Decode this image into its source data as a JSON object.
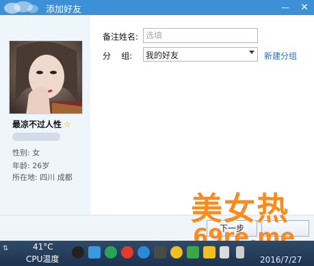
{
  "window": {
    "title": "添加好友",
    "minimize_icon": "minimize-icon",
    "close_icon": "close-icon",
    "minimize_glyph": "—",
    "close_glyph": "✕"
  },
  "profile": {
    "nickname": "最凉不过人性",
    "star_icon": "star-icon",
    "gender": "性别: 女",
    "age": "年龄: 26岁",
    "location": "所在地: 四川  成都"
  },
  "form": {
    "remark_label": "备注姓名:",
    "remark_placeholder": "选填",
    "remark_value": "",
    "group_label": "分    组:",
    "group_value": "我的好友",
    "new_group_link": "新建分组"
  },
  "buttons": {
    "next_label": "下一步"
  },
  "watermark": {
    "main": "美女热",
    "url": "69re.me"
  },
  "taskbar": {
    "cpu_temp": "41°C",
    "cpu_label": "CPU温度",
    "date": "2016/7/27"
  },
  "colors": {
    "titlebar": "#3d8fd6",
    "link": "#2a6ec7",
    "watermark": "#ff8a1c",
    "taskbar": "#1d3350"
  }
}
